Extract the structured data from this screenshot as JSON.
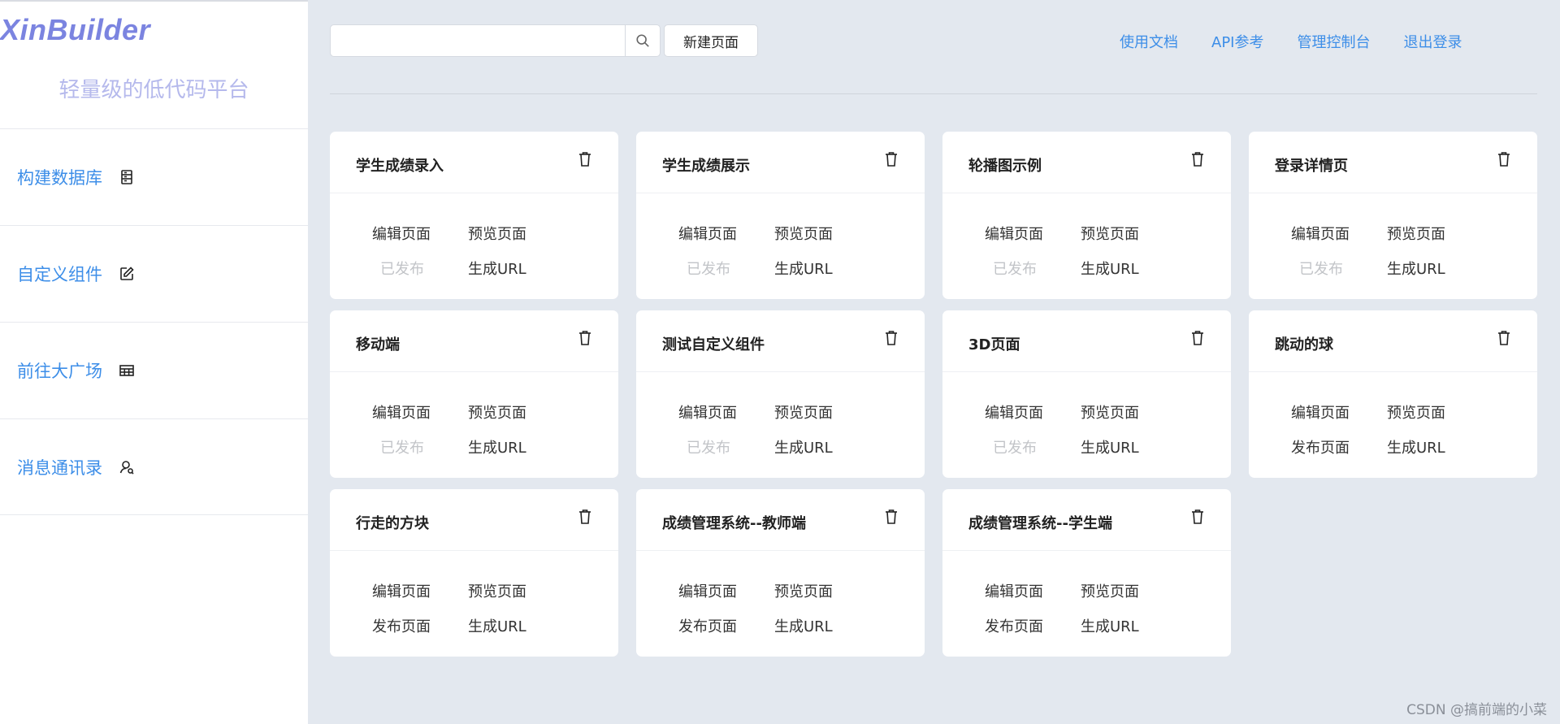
{
  "sidebar": {
    "brand": "XinBuilder",
    "slogan": "轻量级的低代码平台",
    "items": [
      {
        "label": "构建数据库",
        "icon": "database-icon"
      },
      {
        "label": "自定义组件",
        "icon": "edit-icon"
      },
      {
        "label": "前往大广场",
        "icon": "grid-icon"
      },
      {
        "label": "消息通讯录",
        "icon": "contacts-icon"
      }
    ]
  },
  "search": {
    "placeholder": "",
    "value": ""
  },
  "toolbar": {
    "new_page_label": "新建页面"
  },
  "top_links": [
    "使用文档",
    "API参考",
    "管理控制台",
    "退出登录"
  ],
  "cards": [
    {
      "title": "学生成绩录入",
      "edit": "编辑页面",
      "preview": "预览页面",
      "publish": "已发布",
      "published": true,
      "url": "生成URL"
    },
    {
      "title": "学生成绩展示",
      "edit": "编辑页面",
      "preview": "预览页面",
      "publish": "已发布",
      "published": true,
      "url": "生成URL"
    },
    {
      "title": "轮播图示例",
      "edit": "编辑页面",
      "preview": "预览页面",
      "publish": "已发布",
      "published": true,
      "url": "生成URL"
    },
    {
      "title": "登录详情页",
      "edit": "编辑页面",
      "preview": "预览页面",
      "publish": "已发布",
      "published": true,
      "url": "生成URL"
    },
    {
      "title": "移动端",
      "edit": "编辑页面",
      "preview": "预览页面",
      "publish": "已发布",
      "published": true,
      "url": "生成URL"
    },
    {
      "title": "测试自定义组件",
      "edit": "编辑页面",
      "preview": "预览页面",
      "publish": "已发布",
      "published": true,
      "url": "生成URL"
    },
    {
      "title": "3D页面",
      "edit": "编辑页面",
      "preview": "预览页面",
      "publish": "已发布",
      "published": true,
      "url": "生成URL"
    },
    {
      "title": "跳动的球",
      "edit": "编辑页面",
      "preview": "预览页面",
      "publish": "发布页面",
      "published": false,
      "url": "生成URL"
    },
    {
      "title": "行走的方块",
      "edit": "编辑页面",
      "preview": "预览页面",
      "publish": "发布页面",
      "published": false,
      "url": "生成URL"
    },
    {
      "title": "成绩管理系统--教师端",
      "edit": "编辑页面",
      "preview": "预览页面",
      "publish": "发布页面",
      "published": false,
      "url": "生成URL"
    },
    {
      "title": "成绩管理系统--学生端",
      "edit": "编辑页面",
      "preview": "预览页面",
      "publish": "发布页面",
      "published": false,
      "url": "生成URL"
    }
  ],
  "watermark": "CSDN @搞前端的小菜"
}
